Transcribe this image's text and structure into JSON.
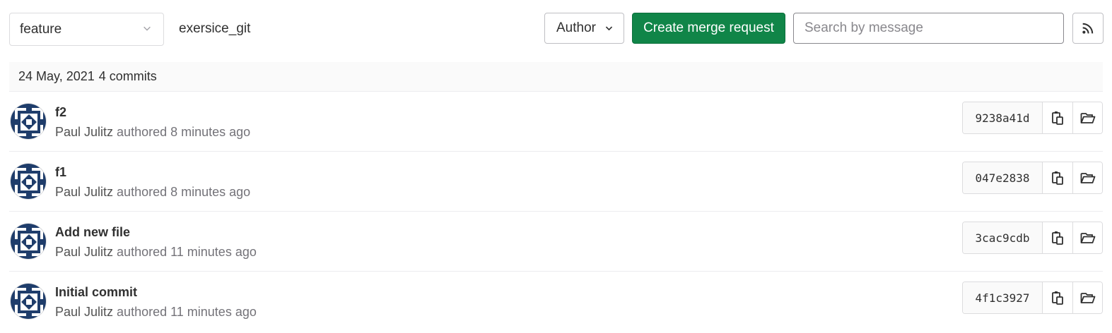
{
  "header": {
    "branch": "feature",
    "repo_path": "exersice_git",
    "author_label": "Author",
    "create_mr_label": "Create merge request",
    "search_placeholder": "Search by message"
  },
  "day_group": {
    "date": "24 May, 2021",
    "count": "4 commits"
  },
  "commits": [
    {
      "title": "f2",
      "author": "Paul Julitz",
      "authored": "authored",
      "time": "8 minutes ago",
      "sha": "9238a41d"
    },
    {
      "title": "f1",
      "author": "Paul Julitz",
      "authored": "authored",
      "time": "8 minutes ago",
      "sha": "047e2838"
    },
    {
      "title": "Add new file",
      "author": "Paul Julitz",
      "authored": "authored",
      "time": "11 minutes ago",
      "sha": "3cac9cdb"
    },
    {
      "title": "Initial commit",
      "author": "Paul Julitz",
      "authored": "authored",
      "time": "11 minutes ago",
      "sha": "4f1c3927"
    }
  ],
  "icons": {
    "branch_chevron": "chevron-down-icon",
    "author_chevron": "chevron-down-icon",
    "rss": "rss-icon",
    "copy": "copy-to-clipboard-icon",
    "browse": "folder-open-icon"
  },
  "colors": {
    "primary_green": "#108548",
    "avatar_navy": "#1f3d6b"
  }
}
